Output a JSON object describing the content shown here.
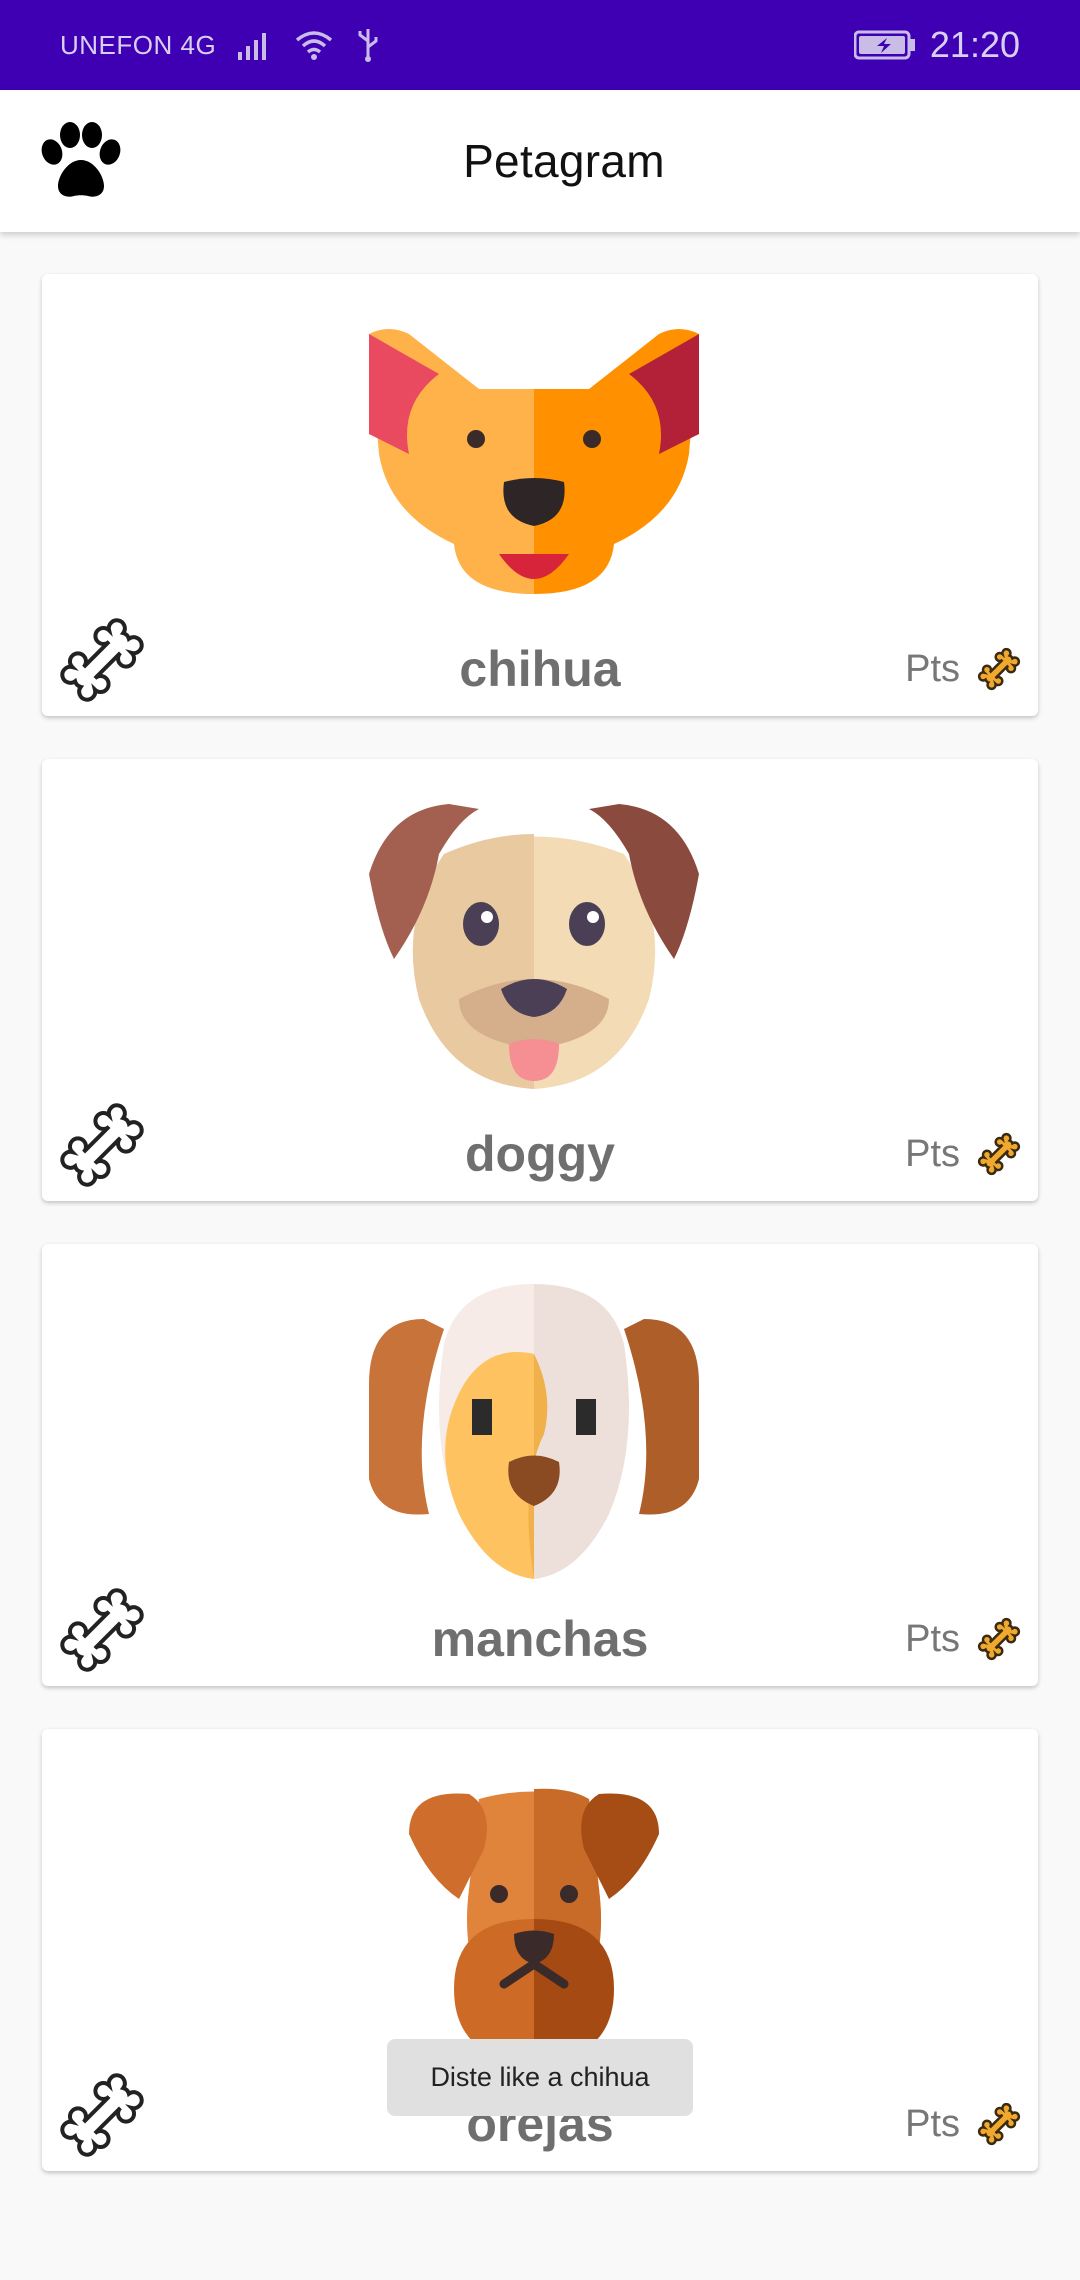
{
  "status_bar": {
    "carrier": "UNEFON 4G",
    "time": "21:20",
    "icons": [
      "signal-icon",
      "wifi-icon",
      "usb-icon",
      "battery-charging-icon"
    ]
  },
  "app_bar": {
    "title": "Petagram",
    "logo_icon": "paw-icon"
  },
  "pets": [
    {
      "name": "chihua",
      "rating_label": "Pts",
      "face_icon": "chihuahua-face-icon"
    },
    {
      "name": "doggy",
      "rating_label": "Pts",
      "face_icon": "puppy-face-icon"
    },
    {
      "name": "manchas",
      "rating_label": "Pts",
      "face_icon": "spotted-dog-face-icon"
    },
    {
      "name": "orejas",
      "rating_label": "Pts",
      "face_icon": "terrier-face-icon"
    }
  ],
  "toast": {
    "message": "Diste like a chihua"
  },
  "colors": {
    "status_bar": "#3f00b3",
    "name_text": "#6f6f6f",
    "rating_bone": "#f0a92e"
  }
}
